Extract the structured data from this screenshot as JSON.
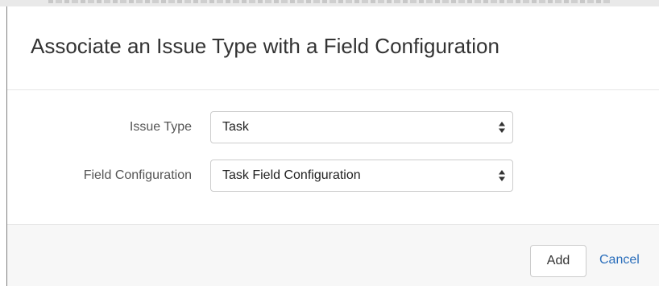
{
  "dialog": {
    "title": "Associate an Issue Type with a Field Configuration"
  },
  "form": {
    "issue_type": {
      "label": "Issue Type",
      "selected": "Task"
    },
    "field_configuration": {
      "label": "Field Configuration",
      "selected": "Task Field Configuration"
    }
  },
  "footer": {
    "add_label": "Add",
    "cancel_label": "Cancel"
  },
  "colors": {
    "link": "#2a6ebb",
    "footer_bg": "#f7f7f7",
    "border": "#cccccc"
  },
  "icons": {
    "select_arrow": "up-down-caret-icon"
  }
}
